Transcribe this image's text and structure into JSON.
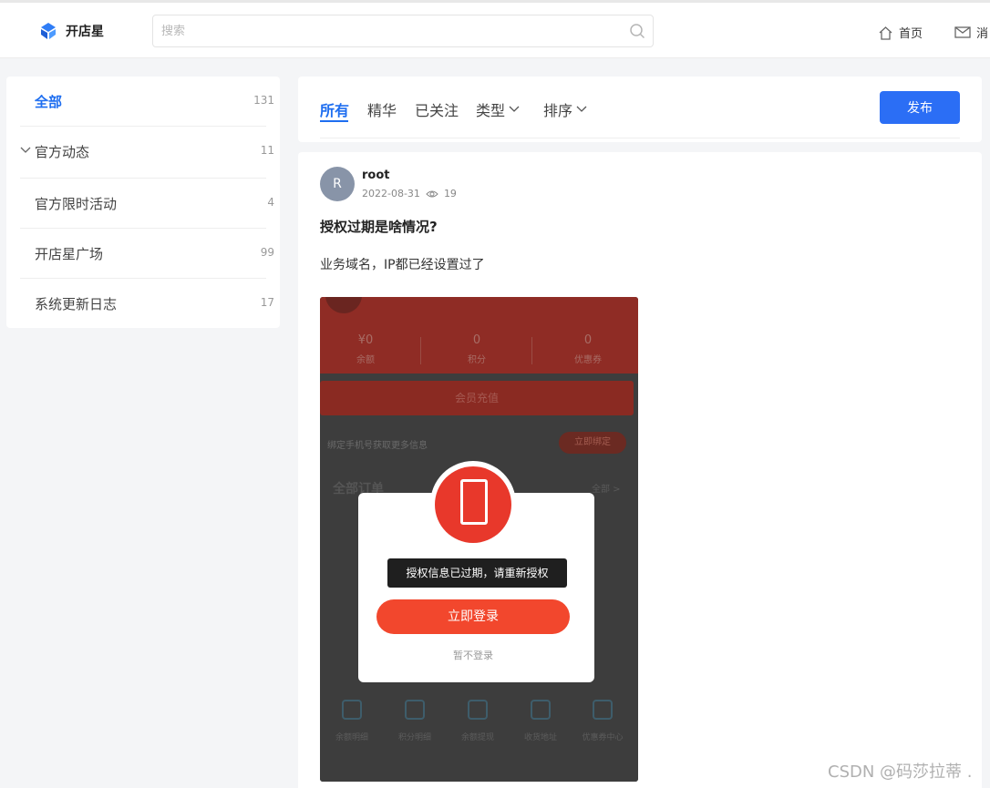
{
  "header": {
    "logo_text": "开店星",
    "search_placeholder": "搜索",
    "nav_home": "首页",
    "nav_messages": "消"
  },
  "sidebar": {
    "items": [
      {
        "label": "全部",
        "count": "131"
      },
      {
        "label": "官方动态",
        "count": "11"
      },
      {
        "label": "官方限时活动",
        "count": "4"
      },
      {
        "label": "开店星广场",
        "count": "99"
      },
      {
        "label": "系统更新日志",
        "count": "17"
      }
    ]
  },
  "tabs": {
    "items": [
      "所有",
      "精华",
      "已关注",
      "类型",
      "排序"
    ],
    "publish_label": "发布"
  },
  "post": {
    "avatar_letter": "R",
    "author": "root",
    "date": "2022-08-31",
    "views": "19",
    "title": "授权过期是啥情况?",
    "body": "业务域名，IP都已经设置过了",
    "image": {
      "stats": [
        {
          "value": "¥0",
          "label": "余额"
        },
        {
          "value": "0",
          "label": "积分"
        },
        {
          "value": "0",
          "label": "优惠券"
        }
      ],
      "member_recharge": "会员充值",
      "bind_text": "绑定手机号获取更多信息",
      "bind_button": "立即绑定",
      "orders_title": "全部订单",
      "orders_all": "全部 >",
      "toast": "授权信息已过期，请重新授权",
      "login_button": "立即登录",
      "skip_login": "暂不登录",
      "bottom_icons": [
        "余额明细",
        "积分明细",
        "余额提现",
        "收货地址",
        "优惠券中心"
      ]
    }
  },
  "watermark": "CSDN @码莎拉蒂 ."
}
